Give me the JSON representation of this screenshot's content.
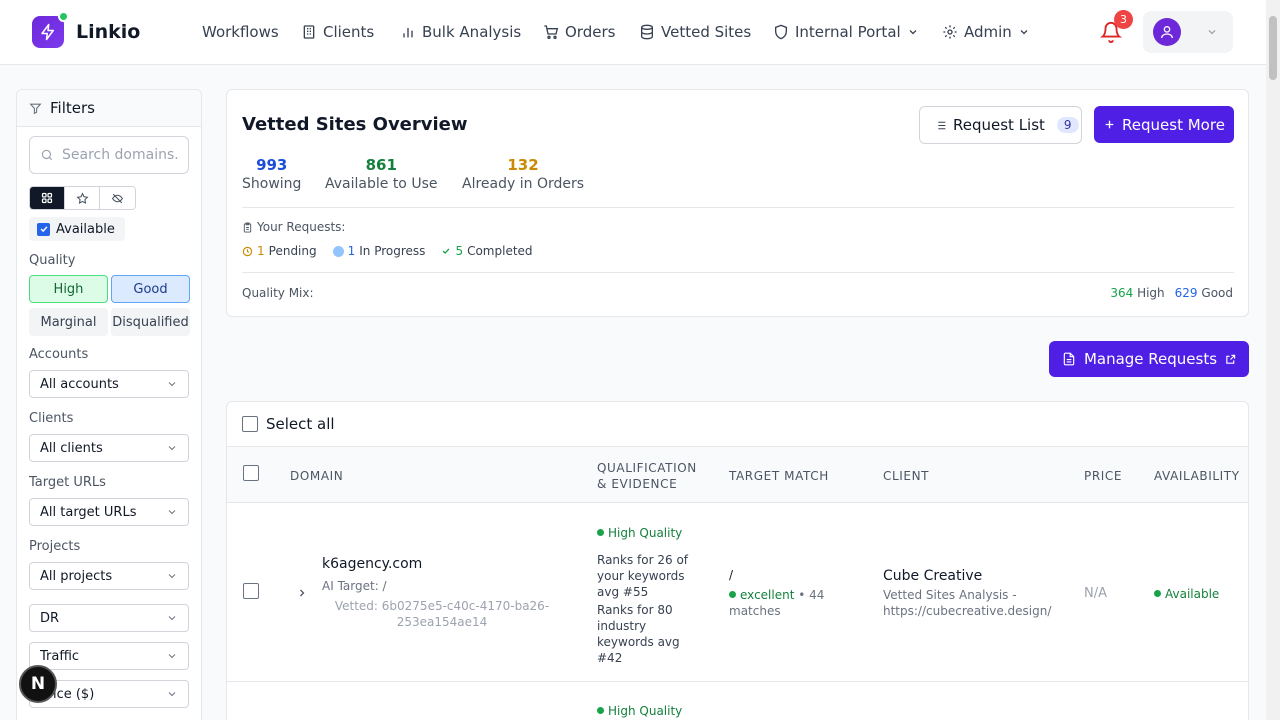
{
  "brand": {
    "name": "Linkio"
  },
  "nav": {
    "items": [
      {
        "label": "Workflows"
      },
      {
        "label": "Clients"
      },
      {
        "label": "Bulk Analysis"
      },
      {
        "label": "Orders"
      },
      {
        "label": "Vetted Sites"
      },
      {
        "label": "Internal Portal"
      },
      {
        "label": "Admin"
      }
    ],
    "notifications": "3"
  },
  "sidebar": {
    "title": "Filters",
    "search_placeholder": "Search domains...",
    "available_label": "Available",
    "quality_label": "Quality",
    "quality": [
      "High",
      "Good",
      "Marginal",
      "Disqualified"
    ],
    "accounts_label": "Accounts",
    "accounts_value": "All accounts",
    "clients_label": "Clients",
    "clients_value": "All clients",
    "targets_label": "Target URLs",
    "targets_value": "All target URLs",
    "projects_label": "Projects",
    "projects_value": "All projects",
    "dr_value": "DR",
    "traffic_value": "Traffic",
    "price_value": "Price ($)"
  },
  "overview": {
    "title": "Vetted Sites Overview",
    "request_list_label": "Request List",
    "request_list_count": "9",
    "request_more_label": "Request More",
    "stats": [
      {
        "value": "993",
        "label": "Showing",
        "color": "#1d4ed8"
      },
      {
        "value": "861",
        "label": "Available to Use",
        "color": "#15803d"
      },
      {
        "value": "132",
        "label": "Already in Orders",
        "color": "#ca8a04"
      }
    ],
    "your_requests_label": "Your Requests:",
    "requests": {
      "pending_count": "1",
      "pending_label": "Pending",
      "progress_count": "1",
      "progress_label": "In Progress",
      "completed_count": "5",
      "completed_label": "Completed"
    },
    "quality_mix_label": "Quality Mix:",
    "quality_mix": {
      "high_count": "364",
      "high_label": "High",
      "good_count": "629",
      "good_label": "Good"
    }
  },
  "manage_requests_label": "Manage Requests",
  "table": {
    "select_all_label": "Select all",
    "headers": {
      "domain": "DOMAIN",
      "qual1": "QUALIFICATION",
      "qual2": "& EVIDENCE",
      "target": "TARGET MATCH",
      "client": "CLIENT",
      "price": "PRICE",
      "availability": "AVAILABILITY"
    },
    "rows": [
      {
        "domain": "k6agency.com",
        "ai_target": "AI Target: /",
        "vetted_1": "Vetted: 6b0275e5-c40c-4170-ba26-",
        "vetted_2": "253ea154ae14",
        "quality": "High Quality",
        "evidence_1": [
          "Ranks for 26 of",
          "your keywords",
          "avg #55"
        ],
        "evidence_2": [
          "Ranks for 80",
          "industry",
          "keywords avg",
          "#42"
        ],
        "target_path": "/",
        "target_match": "excellent",
        "target_matches": "• 44",
        "target_matches_2": "matches",
        "client": "Cube Creative",
        "client_sub_1": "Vetted Sites Analysis -",
        "client_sub_2": "https://cubecreative.design/",
        "price": "N/A",
        "availability": "Available"
      },
      {
        "quality": "High Quality"
      }
    ]
  }
}
